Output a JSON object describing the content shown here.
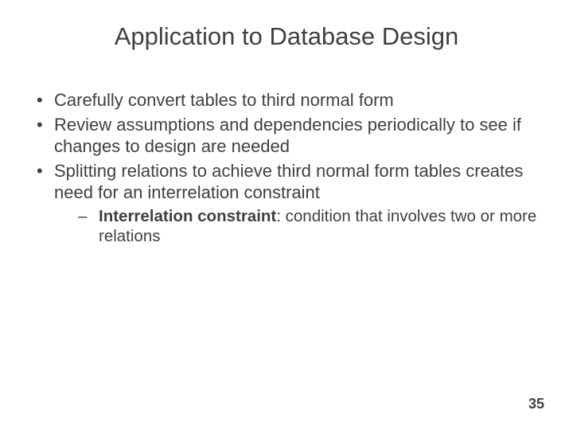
{
  "title": "Application to Database Design",
  "bullets": [
    {
      "text": "Carefully convert tables to third normal form"
    },
    {
      "text": "Review assumptions and dependencies periodically to see if changes to design are needed"
    },
    {
      "text": "Splitting relations to achieve third normal form tables creates need for an interrelation constraint"
    }
  ],
  "sub": {
    "term": "Interrelation constraint",
    "def": ": condition that involves two or more relations"
  },
  "page_number": "35"
}
